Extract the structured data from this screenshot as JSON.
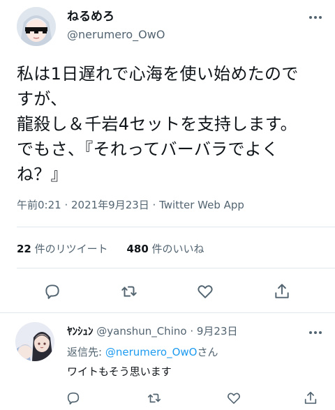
{
  "tweet": {
    "display_name": "ねるめろ",
    "handle": "@nerumero_OwO",
    "lines": [
      "私は1日遅れで心海を使い始めたので",
      "すが、",
      "龍殺し＆千岩4セットを支持します。",
      "でもさ、『それってバーバラでよく",
      "ね？』"
    ],
    "meta": "午前0:21 · 2021年9月23日 · Twitter Web App",
    "retweets": {
      "count": "22",
      "label": "件のリツイート"
    },
    "likes": {
      "count": "480",
      "label": "件のいいね"
    },
    "icons": [
      "more-icon",
      "reply-icon",
      "retweet-icon",
      "like-icon",
      "share-icon"
    ]
  },
  "reply": {
    "display_name": "ﾔﾝｼｭﾝ",
    "handle": "@yanshun_Chino",
    "sep": "·",
    "date": "9月23日",
    "reply_prefix": "返信先: ",
    "reply_target": "@nerumero_OwO",
    "reply_suffix": "さん",
    "text": "ワイトもそう思います"
  },
  "colors": {
    "text": "#0f1419",
    "secondary": "#536471",
    "link": "#1d9bf0",
    "border": "#e1e8ed",
    "background": "#ffffff"
  }
}
